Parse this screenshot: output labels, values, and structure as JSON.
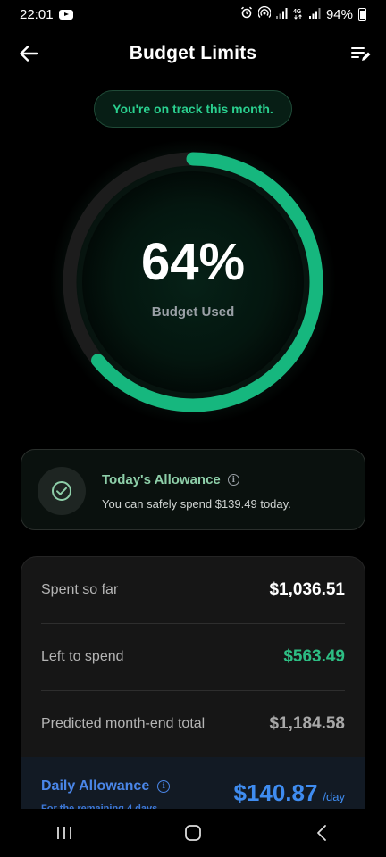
{
  "status_bar": {
    "time": "22:01",
    "battery": "94%",
    "icons": [
      "youtube-icon",
      "alarm-icon",
      "hotspot-icon",
      "signal-icon",
      "4g-icon",
      "signal-icon",
      "battery-icon"
    ]
  },
  "header": {
    "title": "Budget Limits",
    "back_icon": "arrow-left-icon",
    "action_icon": "edit-list-icon"
  },
  "status_pill": {
    "text": "You're on track this month."
  },
  "ring": {
    "percent_text": "64%",
    "percent_value": 0.64,
    "label": "Budget Used",
    "colors": {
      "progress": "#16b77e",
      "track": "#1c1c1c",
      "glow": "#0b2a1e"
    }
  },
  "allowance": {
    "title": "Today's Allowance",
    "description": "You can safely spend $139.49 today.",
    "icon": "check-circle-icon"
  },
  "summary": {
    "rows": [
      {
        "label": "Spent so far",
        "value": "$1,036.51"
      },
      {
        "label": "Left to spend",
        "value": "$563.49"
      },
      {
        "label": "Predicted month-end total",
        "value": "$1,184.58"
      }
    ],
    "daily": {
      "title": "Daily Allowance",
      "subtitle": "For the remaining 4 days",
      "value": "$140.87",
      "unit": "/day"
    }
  },
  "nav_bar": {
    "buttons": [
      "recents-icon",
      "home-icon",
      "back-icon"
    ]
  }
}
